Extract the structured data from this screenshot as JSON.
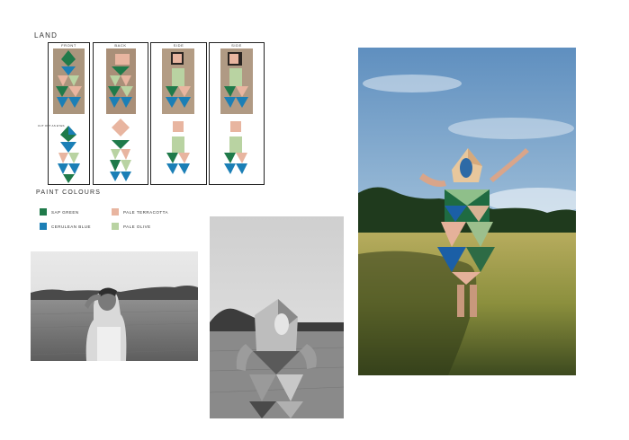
{
  "board": {
    "title": "LAND",
    "paint_heading": "PAINT COLOURS"
  },
  "views": [
    {
      "label": "FRONT"
    },
    {
      "label": "BACK"
    },
    {
      "label": "SIDE"
    },
    {
      "label": "SIDE"
    }
  ],
  "front_note": "CUT OUT AS EYES",
  "paint_colours": [
    {
      "name": "SAP GREEN",
      "color": "#1f7a4a"
    },
    {
      "name": "PALE TERRACOTTA",
      "color": "#e8b5a0"
    },
    {
      "name": "CERULEAN BLUE",
      "color": "#1b7fb6"
    },
    {
      "name": "PALE OLIVE",
      "color": "#b9d3a2"
    }
  ]
}
